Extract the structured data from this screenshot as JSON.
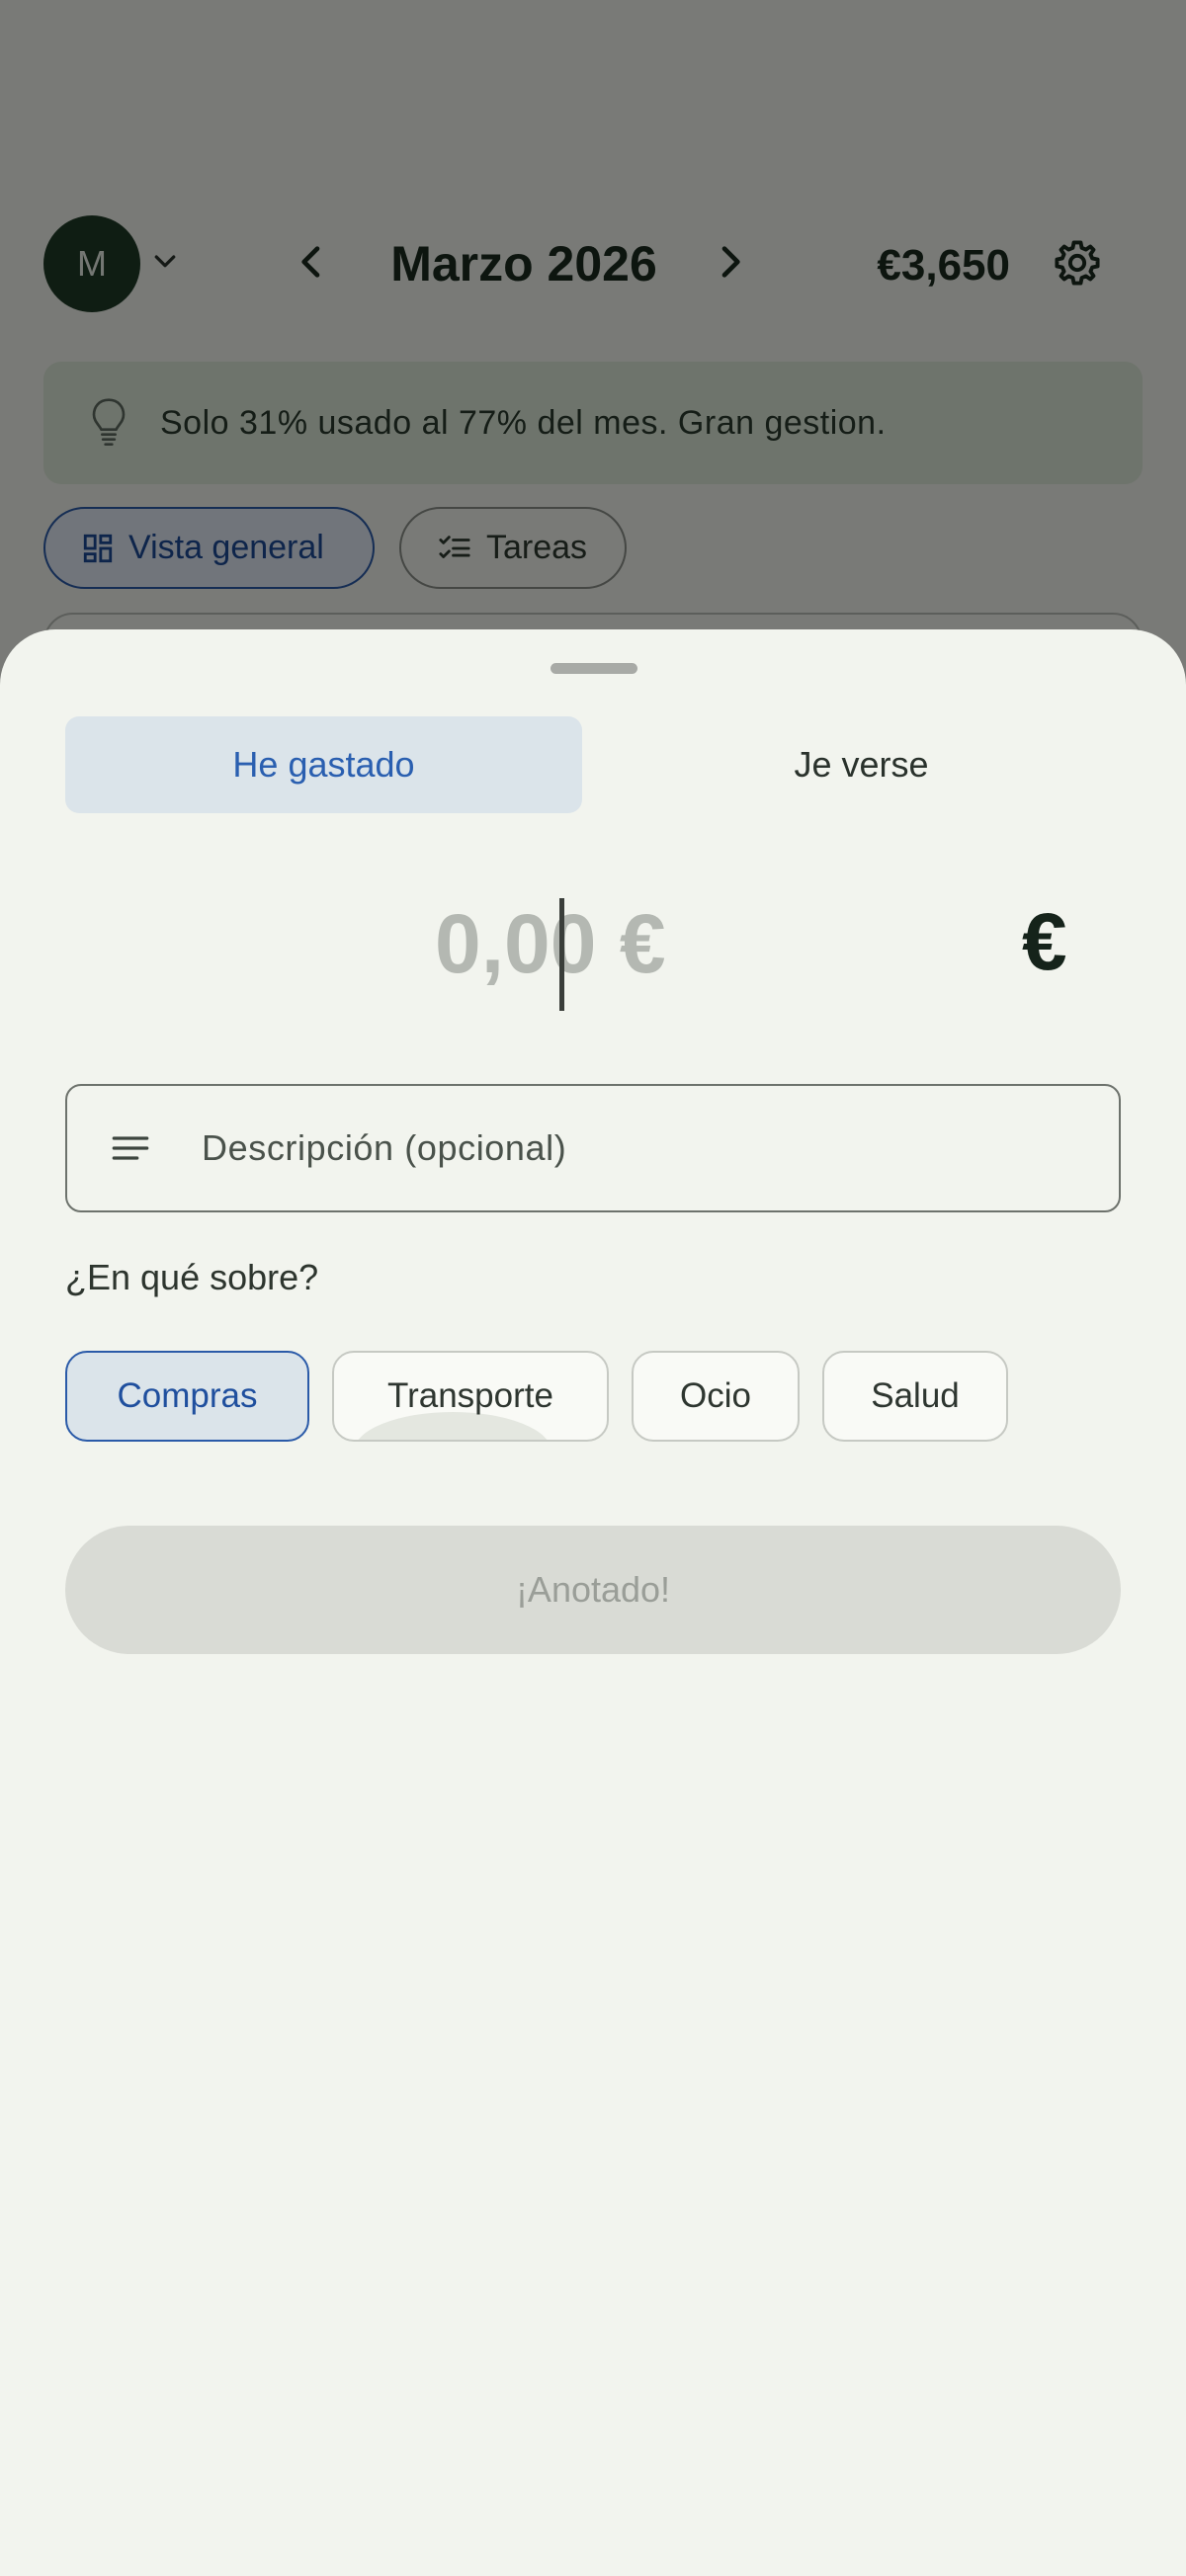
{
  "header": {
    "avatar_initial": "M",
    "month_title": "Marzo 2026",
    "budget_total": "€3,650"
  },
  "tip": {
    "text": "Solo 31% usado al 77% del mes. Gran gestion."
  },
  "view_tabs": [
    {
      "label": "Vista general",
      "selected": true
    },
    {
      "label": "Tareas",
      "selected": false
    }
  ],
  "sheet": {
    "mode_tabs": [
      {
        "label": "He gastado",
        "selected": true
      },
      {
        "label": "Je verse",
        "selected": false
      }
    ],
    "amount_placeholder": "0,00 €",
    "currency_symbol": "€",
    "description_placeholder": "Descripción (opcional)",
    "category_question": "¿En qué sobre?",
    "categories": [
      {
        "label": "Compras",
        "selected": true
      },
      {
        "label": "Transporte",
        "selected": false
      },
      {
        "label": "Ocio",
        "selected": false
      },
      {
        "label": "Salud",
        "selected": false
      }
    ],
    "submit_label": "¡Anotado!"
  },
  "colors": {
    "accent_blue": "#2a5aa8",
    "avatar_green": "#1f3b27",
    "sheet_bg": "#f2f4ee",
    "tip_bg": "#dde9d8"
  },
  "icons": [
    "chevron-down-icon",
    "chevron-left-icon",
    "chevron-right-icon",
    "gear-icon",
    "lightbulb-icon",
    "dashboard-icon",
    "checklist-icon",
    "lines-icon"
  ]
}
